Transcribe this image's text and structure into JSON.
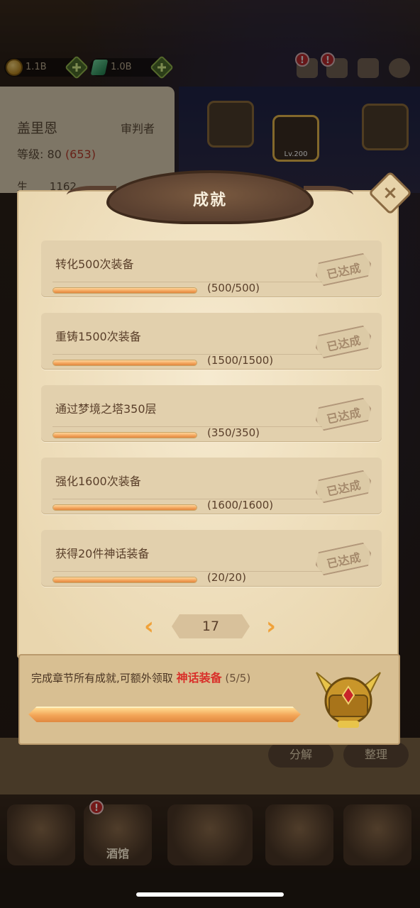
{
  "resources": [
    {
      "icon": "gold-coin-icon",
      "value": "1.1B"
    },
    {
      "icon": "green-gem-icon",
      "value": "1.0B"
    }
  ],
  "hero": {
    "name": "盖里恩",
    "class": "审判者",
    "level_label": "等级: 80",
    "level_extra": "(653)",
    "stat_prefix": "生",
    "stat_value": "1162"
  },
  "equipment": {
    "helmet_level": "Lv.200"
  },
  "modal": {
    "title": "成就",
    "close_icon": "close-icon",
    "achievements": [
      {
        "title": "转化500次装备",
        "progress": "(500/500)",
        "fraction": 1.0,
        "badge": "已达成"
      },
      {
        "title": "重铸1500次装备",
        "progress": "(1500/1500)",
        "fraction": 1.0,
        "badge": "已达成"
      },
      {
        "title": "通过梦境之塔350层",
        "progress": "(350/350)",
        "fraction": 1.0,
        "badge": "已达成"
      },
      {
        "title": "强化1600次装备",
        "progress": "(1600/1600)",
        "fraction": 1.0,
        "badge": "已达成"
      },
      {
        "title": "获得20件神话装备",
        "progress": "(20/20)",
        "fraction": 1.0,
        "badge": "已达成"
      }
    ],
    "page": "17",
    "reward": {
      "text_prefix": "完成章节所有成就,可额外领取",
      "highlight": "神话装备",
      "count": "(5/5)",
      "fraction": 1.0
    }
  },
  "bottom": {
    "decompose_label": "分解",
    "sort_label": "整理",
    "tavern_label": "酒馆"
  },
  "colors": {
    "accent_orange": "#f0a23a",
    "highlight_red": "#d9302a",
    "modal_bg": "#f1e3c4"
  }
}
